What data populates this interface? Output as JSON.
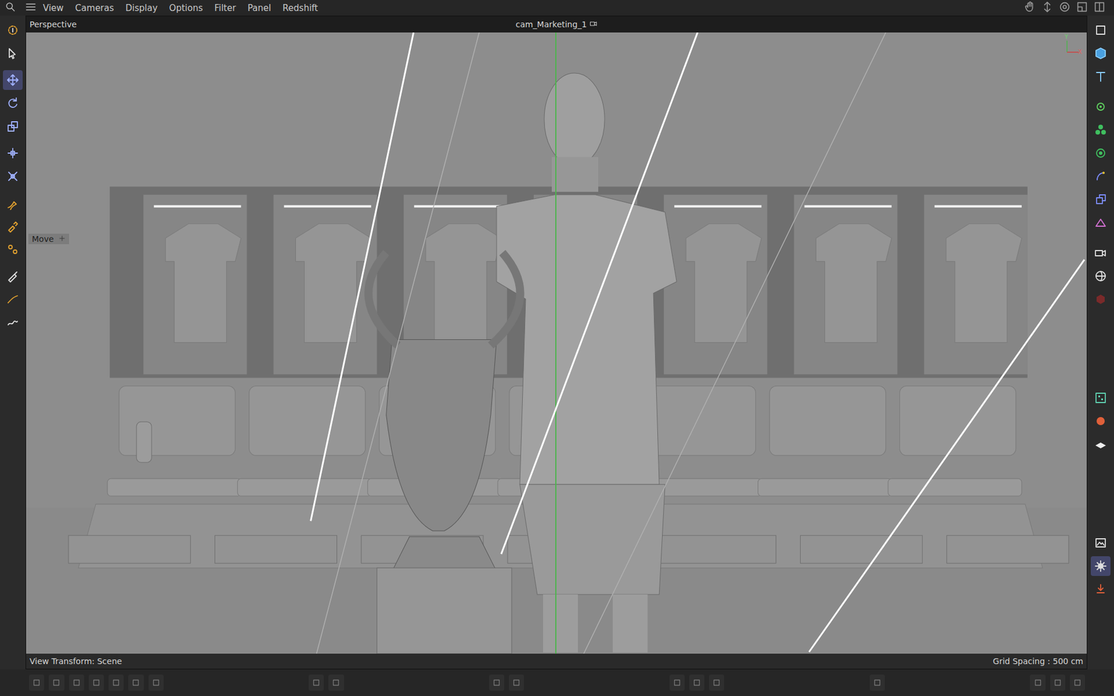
{
  "menu": [
    "View",
    "Cameras",
    "Display",
    "Options",
    "Filter",
    "Panel",
    "Redshift"
  ],
  "viewport": {
    "title": "Perspective",
    "camera": "cam_Marketing_1",
    "tool_hint": "Move",
    "axis_labels": [
      "Y",
      "X"
    ],
    "footer_left": "View Transform: Scene",
    "footer_right": "Grid Spacing : 500 cm"
  },
  "left_tools": [
    {
      "selected": false
    },
    {
      "selected": false
    },
    {
      "selected": true
    },
    {
      "selected": false
    },
    {
      "selected": false
    },
    {
      "selected": false
    },
    {
      "selected": false
    },
    {
      "selected": false
    },
    {
      "selected": false
    },
    {
      "selected": false
    },
    {
      "selected": false
    },
    {
      "selected": false
    },
    {
      "selected": false
    }
  ],
  "right_tools": [
    {
      "selected": false
    },
    {
      "selected": false
    },
    {
      "selected": false
    },
    {
      "selected": false
    },
    {
      "selected": false
    },
    {
      "selected": false
    },
    {
      "selected": false
    },
    {
      "selected": false
    },
    {
      "selected": false
    },
    {
      "selected": false
    },
    {
      "selected": false
    },
    {
      "selected": false
    },
    {
      "selected": false
    },
    {
      "selected": false
    },
    {
      "selected": false
    },
    {
      "selected": false
    },
    {
      "selected": true
    },
    {
      "selected": false
    }
  ]
}
